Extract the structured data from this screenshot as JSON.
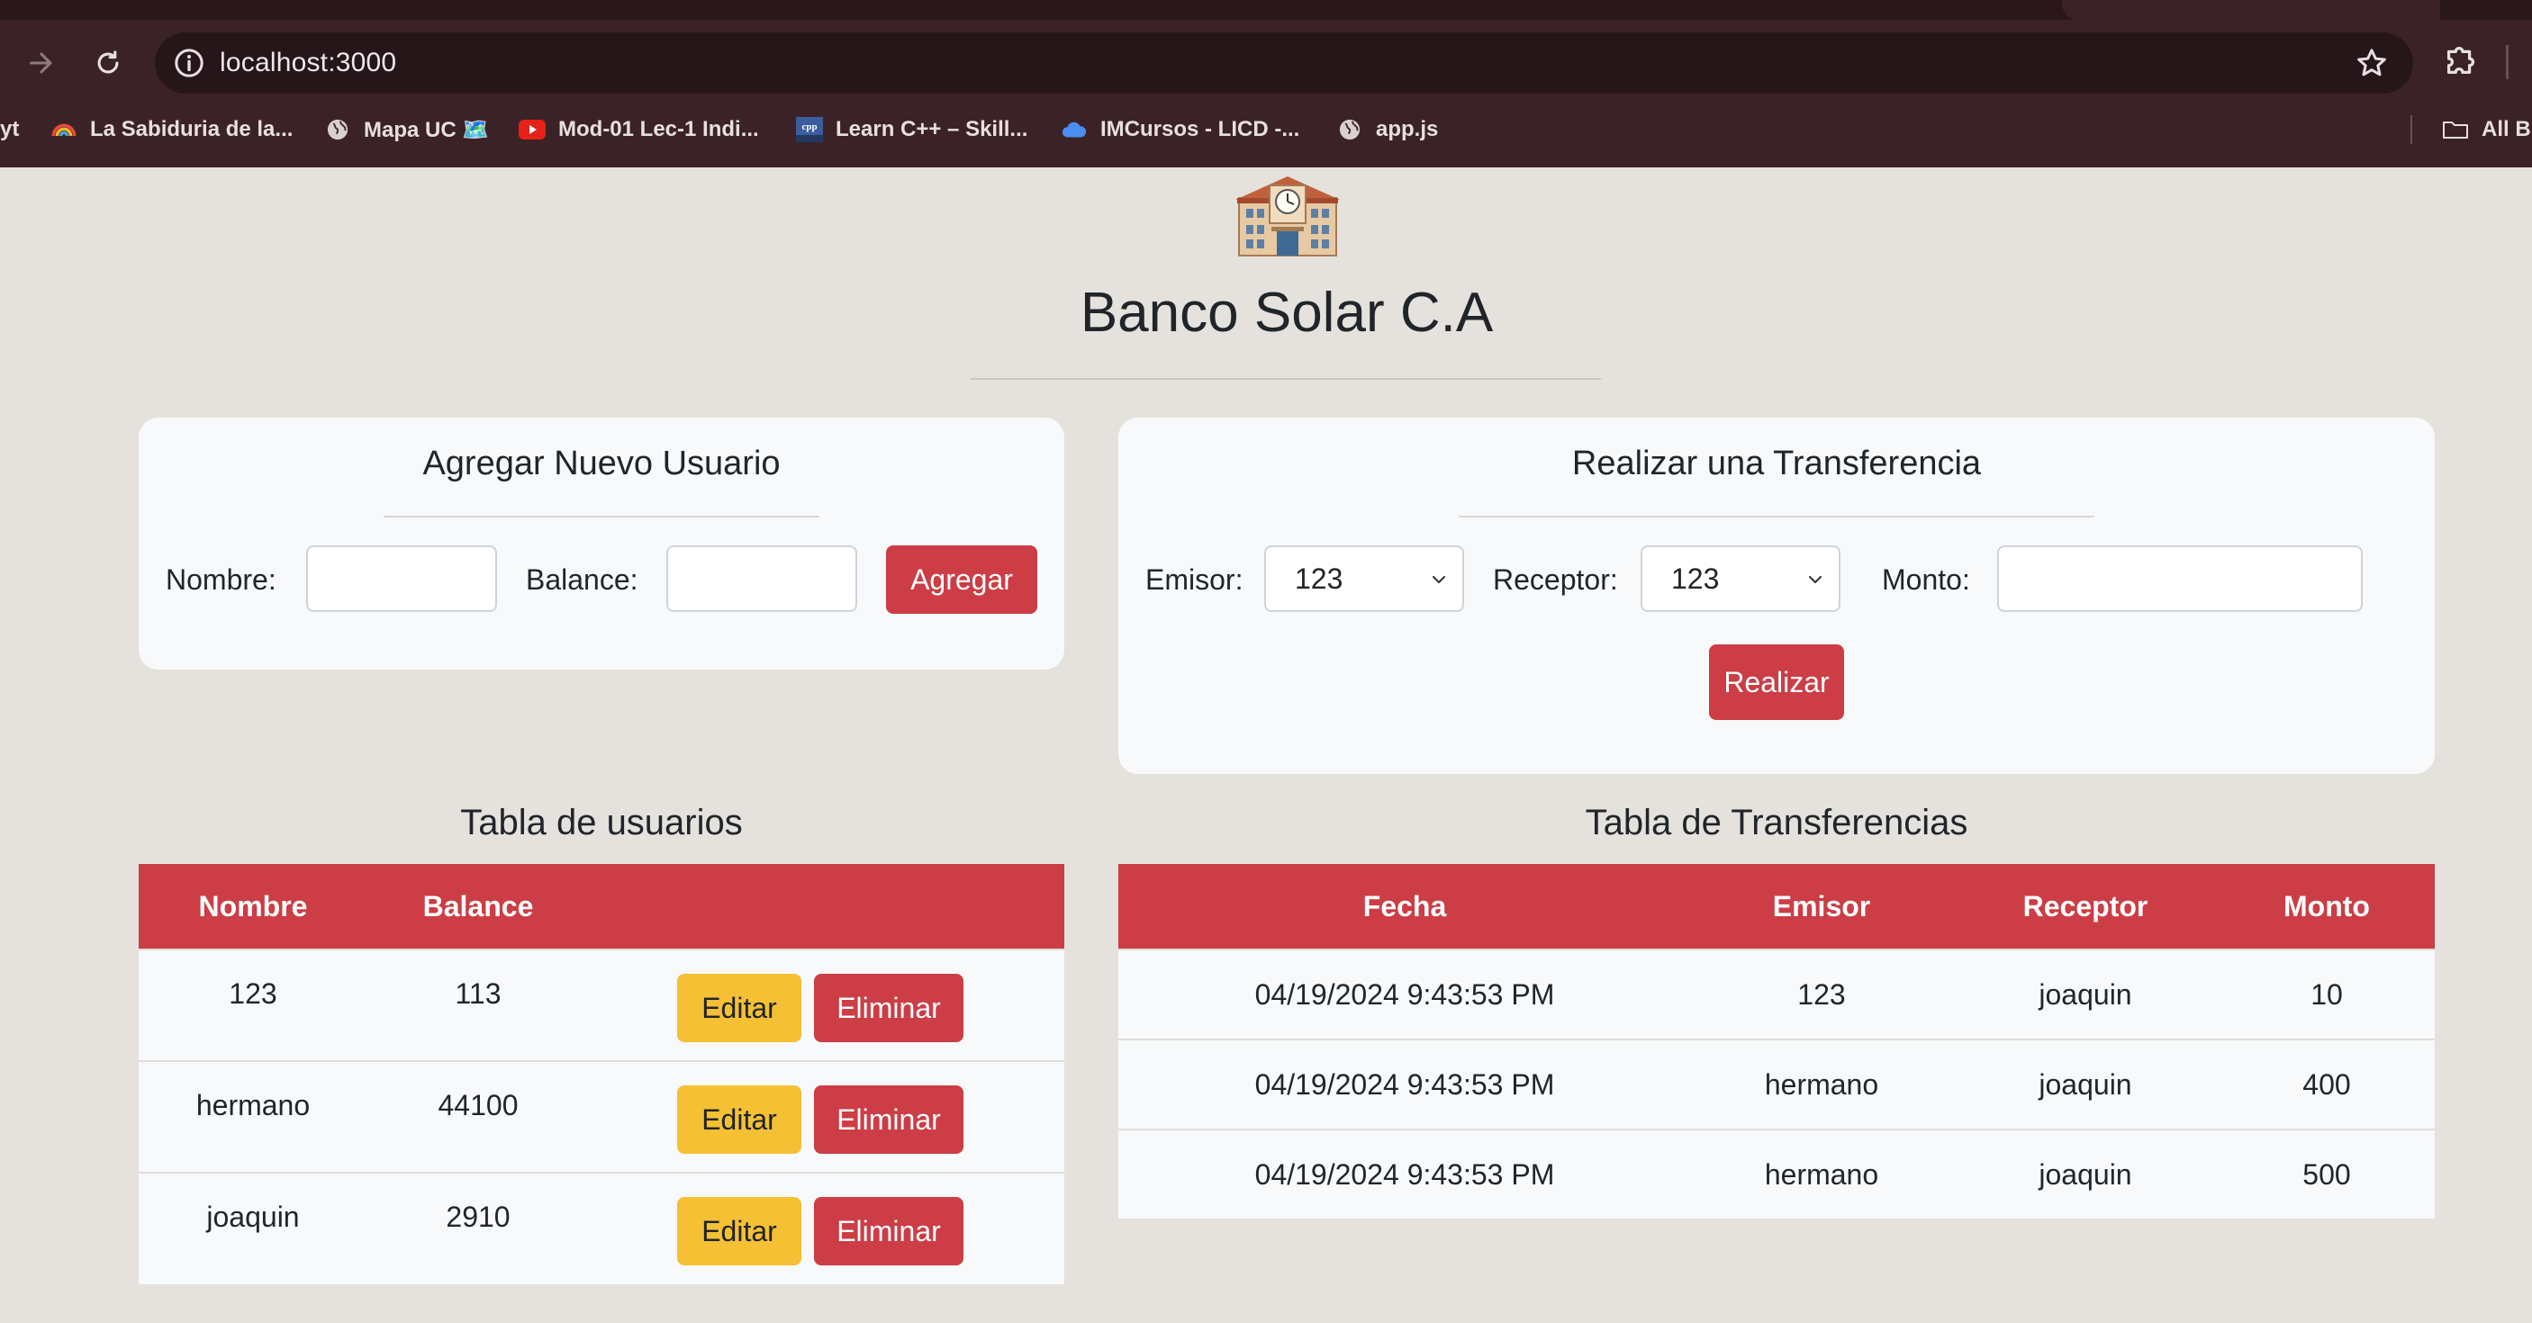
{
  "browser": {
    "url": "localhost:3000",
    "bookmarks": [
      {
        "label": "yt",
        "icon": "text-icon"
      },
      {
        "label": "La Sabiduria de la...",
        "icon": "rainbow-icon"
      },
      {
        "label": "Mapa UC 🗺️",
        "icon": "globe-icon"
      },
      {
        "label": "Mod-01 Lec-1 Indi...",
        "icon": "youtube-icon"
      },
      {
        "label": "Learn C++ – Skill...",
        "icon": "cpp-icon"
      },
      {
        "label": "IMCursos - LICD -...",
        "icon": "cloud-icon"
      },
      {
        "label": "app.js",
        "icon": "globe-icon"
      },
      {
        "label": "All B",
        "icon": "folder-icon"
      }
    ]
  },
  "page": {
    "logo": "🏫",
    "title": "Banco Solar C.A"
  },
  "add_user": {
    "title": "Agregar Nuevo Usuario",
    "name_label": "Nombre:",
    "name_value": "",
    "balance_label": "Balance:",
    "balance_value": "",
    "submit_label": "Agregar"
  },
  "transfer": {
    "title": "Realizar una Transferencia",
    "sender_label": "Emisor:",
    "sender_value": "123",
    "receiver_label": "Receptor:",
    "receiver_value": "123",
    "amount_label": "Monto:",
    "amount_value": "",
    "submit_label": "Realizar"
  },
  "users_table": {
    "title": "Tabla de usuarios",
    "headers": [
      "Nombre",
      "Balance",
      ""
    ],
    "edit_label": "Editar",
    "delete_label": "Eliminar",
    "rows": [
      {
        "nombre": "123",
        "balance": "113"
      },
      {
        "nombre": "hermano",
        "balance": "44100"
      },
      {
        "nombre": "joaquin",
        "balance": "2910"
      }
    ]
  },
  "transfers_table": {
    "title": "Tabla de Transferencias",
    "headers": [
      "Fecha",
      "Emisor",
      "Receptor",
      "Monto"
    ],
    "rows": [
      {
        "fecha": "04/19/2024 9:43:53 PM",
        "emisor": "123",
        "receptor": "joaquin",
        "monto": "10"
      },
      {
        "fecha": "04/19/2024 9:43:53 PM",
        "emisor": "hermano",
        "receptor": "joaquin",
        "monto": "400"
      },
      {
        "fecha": "04/19/2024 9:43:53 PM",
        "emisor": "hermano",
        "receptor": "joaquin",
        "monto": "500"
      }
    ]
  },
  "colors": {
    "page_bg": "#e5e2dd",
    "danger": "#cc3d46",
    "warning": "#f5c034",
    "card_bg": "#f8f9fa",
    "chrome_bg": "#3b2226"
  }
}
